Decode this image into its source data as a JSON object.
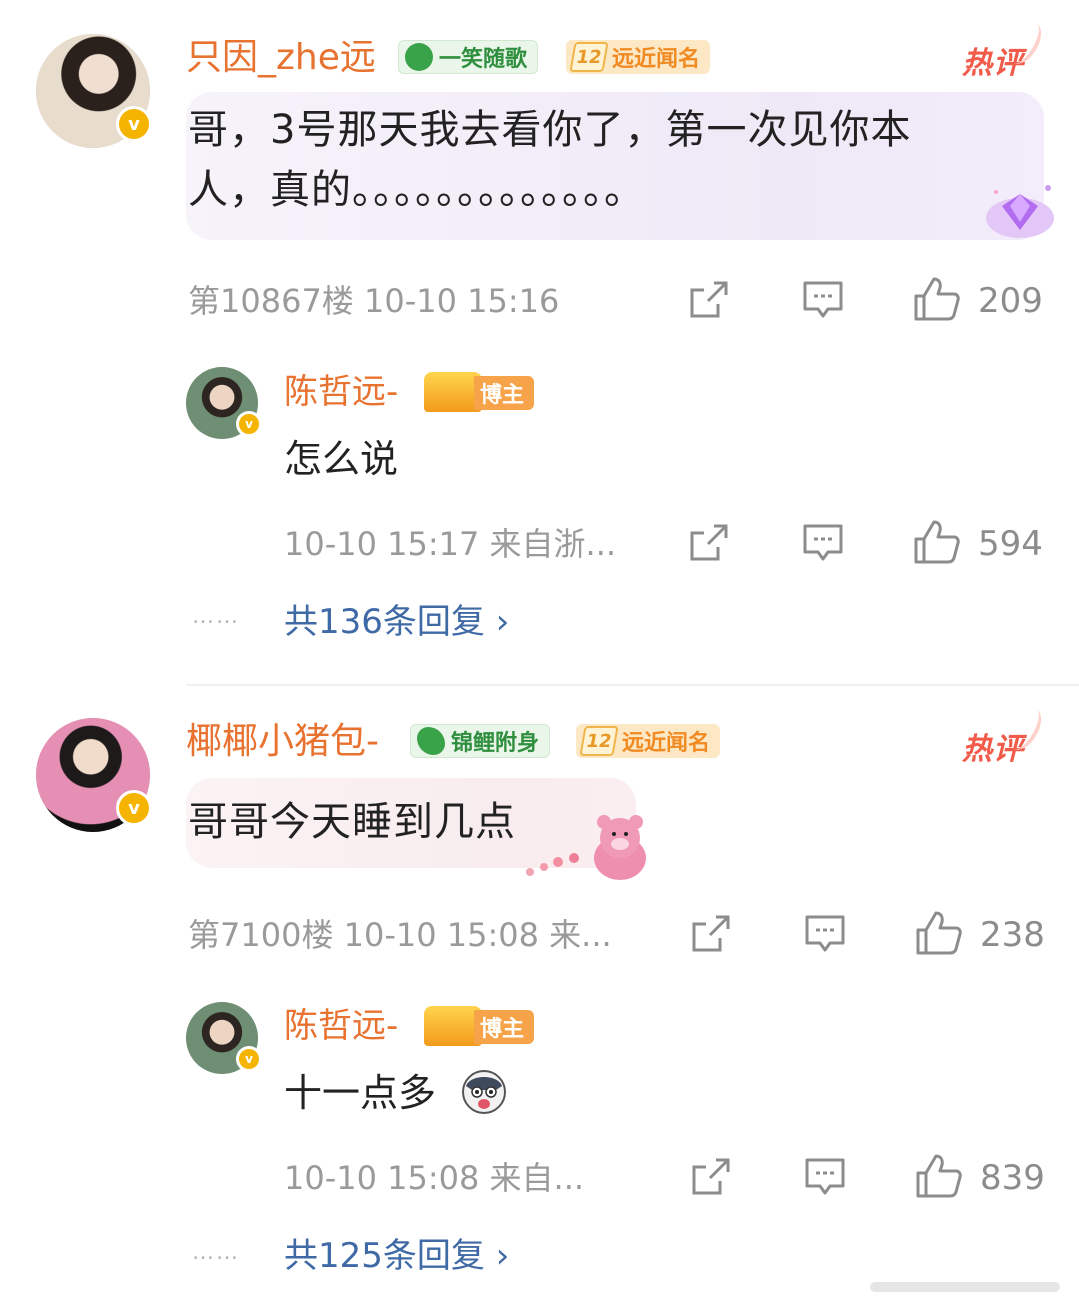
{
  "comments": [
    {
      "username": "只因_zhe远",
      "badge_label": "一笑随歌",
      "fan_level": "12",
      "fan_badge_label": "远近闻名",
      "hot_label": "热评",
      "text_line1": "哥，3号那天我去看你了，第一次见你本",
      "text_line2": "人，真的。。。。。。。。。。。。。",
      "meta": "第10867楼 10-10 15:16",
      "likes": "209",
      "reply": {
        "username": "陈哲远-",
        "role_badge": "博主",
        "text": "怎么说",
        "meta": "10-10 15:17  来自浙...",
        "likes": "594"
      },
      "replies_link": "共136条回复 ›"
    },
    {
      "username": "椰椰小猪包-",
      "badge_label": "锦鲤附身",
      "fan_level": "12",
      "fan_badge_label": "远近闻名",
      "hot_label": "热评",
      "text_line1": "哥哥今天睡到几点",
      "meta": "第7100楼 10-10 15:08  来...",
      "likes": "238",
      "reply": {
        "username": "陈哲远-",
        "role_badge": "博主",
        "text": "十一点多",
        "meta": "10-10 15:08  来自...",
        "likes": "839"
      },
      "replies_link": "共125条回复 ›"
    }
  ],
  "ellipsis": "……",
  "colors": {
    "username": "#e8722f",
    "link": "#3f6aa6",
    "meta": "#9a9a9a",
    "hot": "#f25a4a"
  },
  "icons": [
    "share-icon",
    "comment-icon",
    "like-icon",
    "verified-icon",
    "crown-icon",
    "clover-icon",
    "koi-icon"
  ]
}
